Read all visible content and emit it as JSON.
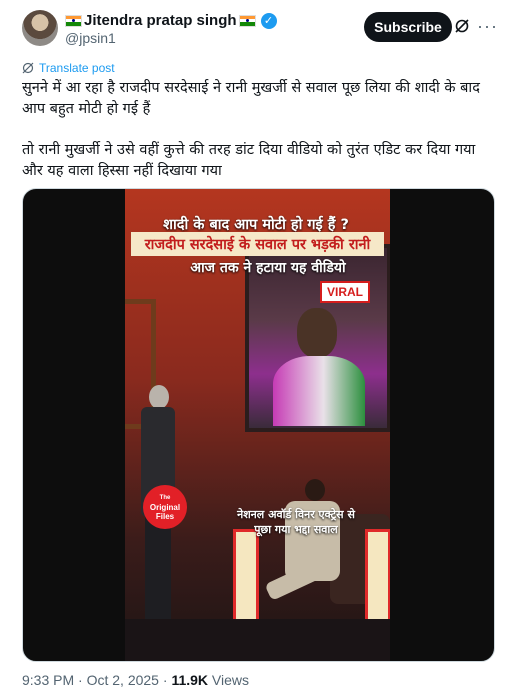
{
  "author": {
    "display_name": "Jitendra pratap singh",
    "handle": "@jpsin1",
    "verified": true
  },
  "actions": {
    "subscribe_label": "Subscribe",
    "more_icon": "more-icon",
    "grok_icon": "grok-icon"
  },
  "translate_label": "Translate post",
  "post": {
    "paragraphs": [
      "सुनने में आ रहा है राजदीप सरदेसाई ने रानी मुखर्जी से सवाल पूछ लिया की शादी के बाद आप बहुत मोटी हो गई हैं",
      "तो रानी मुखर्जी ने उसे वहीं कुत्ते की तरह डांट दिया वीडियो को तुरंत एडिट कर दिया गया और यह वाला हिस्सा नहीं दिखाया गया"
    ]
  },
  "video": {
    "caption_line1": "शादी के बाद आप मोटी हो गई हैं ?",
    "caption_line2": "राजदीप सरदेसाई के सवाल पर भड़की रानी",
    "caption_line3": "आज तक ने हटाया यह वीडियो",
    "badge": "VIRAL",
    "logo_the": "The",
    "logo_text": "Original Files",
    "caption_bottom": "नेशनल अवॉर्ड विनर एक्ट्रेस से पूछा गया भद्दा सवाल"
  },
  "meta": {
    "time": "9:33 PM",
    "separator": "·",
    "date": "Oct 2, 2025",
    "views_count": "11.9K",
    "views_label": "Views"
  },
  "colors": {
    "accent": "#1d9bf0",
    "text": "#0f1419",
    "muted": "#536471"
  }
}
